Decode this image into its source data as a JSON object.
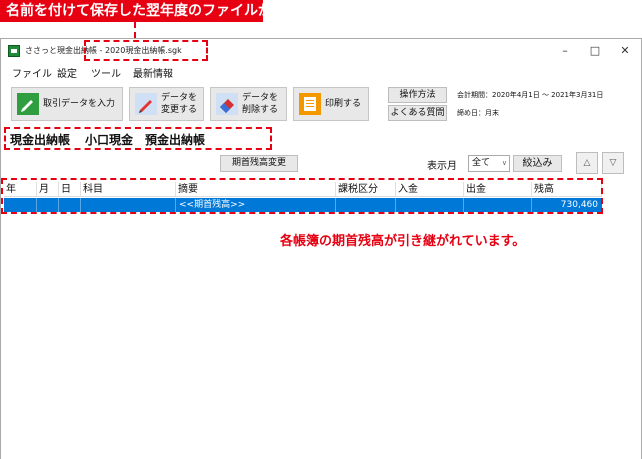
{
  "annotations": {
    "top_banner": "名前を付けて保存した翌年度のファイルが表示されます",
    "grid_caption": "各帳簿の期首残高が引き継がれています。"
  },
  "window": {
    "title_app": "ささっと現金出納帳",
    "title_file": " - 2020現金出納帳.sgk",
    "minimize": "–",
    "maximize": "□",
    "close": "✕"
  },
  "menu": [
    "ファイル",
    "設定",
    "ツール",
    "最新情報"
  ],
  "toolbar": {
    "entry_label": "取引データを入力",
    "edit_label": "データを\n変更する",
    "delete_label": "データを\n削除する",
    "print_label": "印刷する",
    "howto_label": "操作方法",
    "faq_label": "よくある質問",
    "fiscal_period": "会計期間：2020年4月1日 ～ 2021年3月31日",
    "closing_day": "締め日：月末"
  },
  "tabs": [
    "現金出納帳",
    "小口現金",
    "預金出納帳"
  ],
  "controls": {
    "opening_balance_btn": "期首残高変更",
    "display_month_label": "表示月",
    "display_month_value": "全て",
    "filter_btn": "絞込み",
    "up_icon": "△",
    "down_icon": "▽"
  },
  "table": {
    "headers": [
      "年",
      "月",
      "日",
      "科目",
      "摘要",
      "課税区分",
      "入金",
      "出金",
      "残高"
    ],
    "rows": [
      {
        "description": "<<期首残高>>",
        "balance": "730,460"
      }
    ]
  },
  "icon_colors": {
    "entry": "#2f9e41",
    "edit": "#e3342f",
    "delete": "#d32f2f",
    "print": "#f39800",
    "accent_red": "#e60012",
    "selection_blue": "#0078d7"
  }
}
